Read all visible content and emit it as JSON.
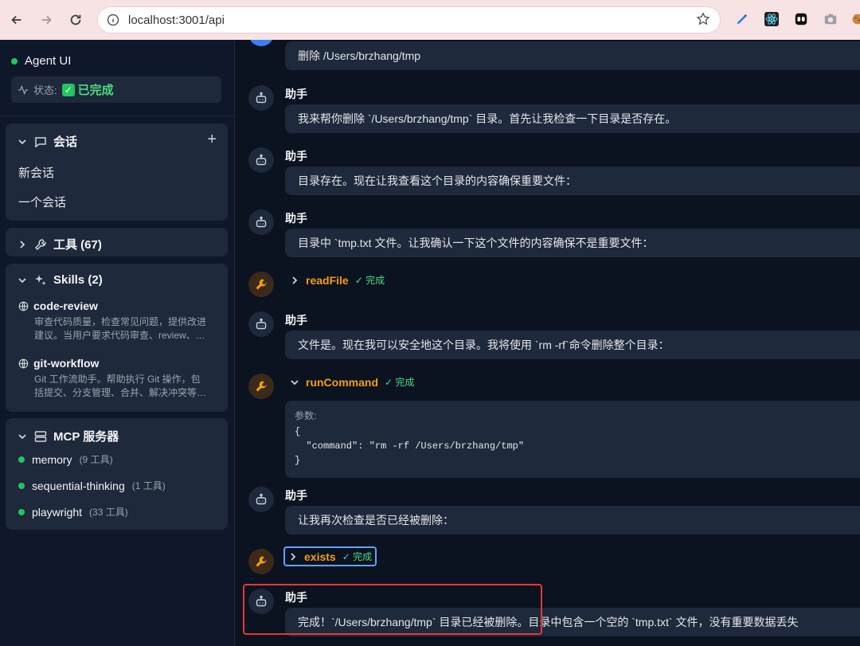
{
  "browser": {
    "url": "localhost:3001/api",
    "back_icon": "arrow-left-icon",
    "forward_icon": "arrow-right-icon",
    "reload_icon": "reload-icon"
  },
  "sidebar": {
    "app_title": "Agent UI",
    "status_label": "状态:",
    "status_value": "已完成",
    "conversations": {
      "title": "会话",
      "items": [
        "新会话",
        "一个会话"
      ]
    },
    "tools": {
      "title": "工具 (67)"
    },
    "skills": {
      "title": "Skills (2)",
      "items": [
        {
          "name": "code-review",
          "desc_line1": "审查代码质量，检查常见问题，提供改进",
          "desc_line2": "建议。当用户要求代码审查、review、…"
        },
        {
          "name": "git-workflow",
          "desc_line1": "Git 工作流助手。帮助执行 Git 操作，包",
          "desc_line2": "括提交、分支管理、合并、解决冲突等…"
        }
      ]
    },
    "mcp": {
      "title": "MCP 服务器",
      "items": [
        {
          "name": "memory",
          "count": "(9 工具)"
        },
        {
          "name": "sequential-thinking",
          "count": "(1 工具)"
        },
        {
          "name": "playwright",
          "count": "(33 工具)"
        }
      ]
    }
  },
  "chat": {
    "user_message": "删除 /Users/brzhang/tmp",
    "assistant_name": "助手",
    "messages": [
      "我来帮你删除 `/Users/brzhang/tmp` 目录。首先让我检查一下目录是否存在。",
      "目录存在。现在让我查看这个目录的内容确保重要文件：",
      "目录中 `tmp.txt 文件。让我确认一下这个文件的内容确保不是重要文件：",
      "文件是。现在我可以安全地这个目录。我将使用 `rm -rf`命令删除整个目录：",
      "让我再次检查是否已经被删除：",
      "完成！`/Users/brzhang/tmp` 目录已经被删除。目录中包含一个空的 `tmp.txt` 文件，没有重要数据丢失"
    ],
    "tools": [
      {
        "name": "readFile",
        "status": "✓ 完成"
      },
      {
        "name": "runCommand",
        "status": "✓ 完成"
      },
      {
        "name": "exists",
        "status": "✓ 完成"
      }
    ],
    "params": {
      "label": "参数:",
      "line1": "{",
      "line2": "  \"command\": \"rm -rf /Users/brzhang/tmp\"",
      "line3": "}"
    }
  }
}
